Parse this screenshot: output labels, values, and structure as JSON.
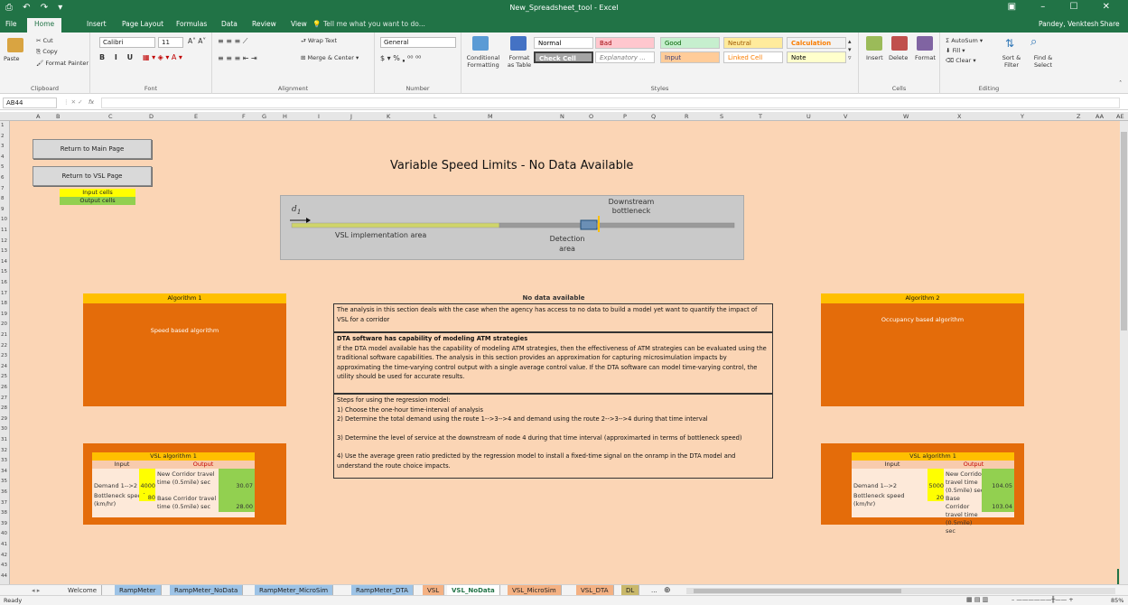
{
  "window": {
    "title": "New_Spreadsheet_tool - Excel",
    "user": "Pandey, Venktesh",
    "share": "Share"
  },
  "ribbon_tabs": [
    "File",
    "Home",
    "Insert",
    "Page Layout",
    "Formulas",
    "Data",
    "Review",
    "View"
  ],
  "tell_me": "Tell me what you want to do...",
  "clipboard": {
    "paste": "Paste",
    "cut": "Cut",
    "copy": "Copy",
    "format_painter": "Format Painter",
    "label": "Clipboard"
  },
  "font": {
    "name": "Calibri",
    "size": "11",
    "label": "Font"
  },
  "alignment": {
    "wrap": "Wrap Text",
    "merge": "Merge & Center",
    "label": "Alignment"
  },
  "number": {
    "format": "General",
    "label": "Number"
  },
  "styles": {
    "conditional": "Conditional Formatting",
    "format_table": "Format as Table",
    "cells": [
      {
        "label": "Normal",
        "bg": "#ffffff",
        "fg": "#000000"
      },
      {
        "label": "Bad",
        "bg": "#ffc7ce",
        "fg": "#9c0006"
      },
      {
        "label": "Good",
        "bg": "#c6efce",
        "fg": "#006100"
      },
      {
        "label": "Neutral",
        "bg": "#ffeb9c",
        "fg": "#9c5700"
      },
      {
        "label": "Calculation",
        "bg": "#f2f2f2",
        "fg": "#fa7d00"
      },
      {
        "label": "Check Cell",
        "bg": "#a5a5a5",
        "fg": "#ffffff"
      },
      {
        "label": "Explanatory ...",
        "bg": "#ffffff",
        "fg": "#7f7f7f"
      },
      {
        "label": "Input",
        "bg": "#ffcc99",
        "fg": "#3f3f76"
      },
      {
        "label": "Linked Cell",
        "bg": "#ffffff",
        "fg": "#fa7d00"
      },
      {
        "label": "Note",
        "bg": "#ffffcc",
        "fg": "#000000"
      }
    ],
    "label": "Styles"
  },
  "cells_group": {
    "insert": "Insert",
    "delete": "Delete",
    "format": "Format",
    "label": "Cells"
  },
  "editing": {
    "autosum": "AutoSum",
    "fill": "Fill",
    "clear": "Clear",
    "sort": "Sort & Filter",
    "find": "Find & Select",
    "label": "Editing"
  },
  "formula_bar": {
    "name_box": "AB44",
    "fx": "fx",
    "value": ""
  },
  "columns": [
    "A",
    "B",
    "C",
    "D",
    "E",
    "F",
    "G",
    "H",
    "I",
    "J",
    "K",
    "L",
    "M",
    "N",
    "O",
    "P",
    "Q",
    "R",
    "S",
    "T",
    "U",
    "V",
    "W",
    "X",
    "Y",
    "Z",
    "AA",
    "AE"
  ],
  "rows": [
    "1",
    "2",
    "3",
    "4",
    "5",
    "6",
    "7",
    "8",
    "9",
    "10",
    "11",
    "12",
    "13",
    "14",
    "15",
    "16",
    "17",
    "18",
    "19",
    "20",
    "21",
    "22",
    "23",
    "24",
    "25",
    "26",
    "27",
    "28",
    "29",
    "30",
    "31",
    "32",
    "33",
    "34",
    "35",
    "36",
    "37",
    "38",
    "39",
    "40",
    "41",
    "42",
    "43",
    "44"
  ],
  "buttons": {
    "main": "Return to Main Page",
    "vsl": "Return to VSL Page"
  },
  "legend": {
    "input": "Input cells",
    "output": "Output cells"
  },
  "page_title": "Variable Speed Limits - No Data Available",
  "diagram": {
    "d1": "d",
    "sub": "1",
    "downstream": "Downstream bottleneck",
    "vsl_area": "VSL implementation area",
    "detection": "Detection area"
  },
  "algo1": {
    "title": "Algorithm 1",
    "body": "Speed based algorithm"
  },
  "algo2": {
    "title": "Algorithm 2",
    "body": "Occupancy based algorithm"
  },
  "no_data": {
    "title": "No data available",
    "p1": "The analysis in this section deals with the case when the agency has access to no data to build a model yet want to quantify the impact of VSL for a corridor",
    "dta_title": "DTA software has capability of modeling ATM strategies",
    "dta_body": "If the DTA model available has the capability of modeling ATM strategies, then the effectiveness of ATM strategies can be evaluated using the traditional software capabilities. The analysis in this section provides an approximation for capturing microsimulation impacts by approximating the time-varying control output with a single average control value. If the DTA software can model time-varying control, the utility should be used for accurate results.",
    "steps_title": "Steps for using the regression model:",
    "s1": "1) Choose the one-hour time-interval of analysis",
    "s2": "2) Determine the total demand using the route 1-->3-->4 and demand using the route 2-->3-->4 during that time interval",
    "s3": "3) Determine the level of service at the downstream of node 4 during that time interval (approximarted in terms of bottleneck speed)",
    "s4": "4) Use the average green ratio predicted by the regression model to install a fixed-time signal on the onramp in the DTA model and understand the route choice impacts."
  },
  "vsl1": {
    "title": "VSL algorithm 1",
    "input": "Input",
    "output": "Output",
    "demand_label": "Demand 1-->2",
    "demand": "4000",
    "bn_label": "Bottleneck speed (km/hr)",
    "bn": "80",
    "new_label": "New Corridor travel time (0.5mile) sec",
    "new_val": "30.07",
    "base_label": "Base Corridor travel time (0.5mile) sec",
    "base_val": "28.00"
  },
  "vsl2": {
    "title": "VSL algorithm 1",
    "input": "Input",
    "output": "Output",
    "demand_label": "Demand 1-->2",
    "demand": "5000",
    "bn_label": "Bottleneck speed (km/hr)",
    "bn": "20",
    "new_label": "New Corridor travel time (0.5mile) sec",
    "new_val": "104.05",
    "base_label": "Base Corridor travel time (0.5mile) sec",
    "base_val": "103.04"
  },
  "sheet_tabs": [
    {
      "label": "Welcome",
      "bg": "#f3f3f3",
      "fg": "#333"
    },
    {
      "label": "RampMeter",
      "bg": "#9dc3e6",
      "fg": "#222"
    },
    {
      "label": "RampMeter_NoData",
      "bg": "#9dc3e6",
      "fg": "#222"
    },
    {
      "label": "RampMeter_MicroSim",
      "bg": "#9dc3e6",
      "fg": "#222"
    },
    {
      "label": "RampMeter_DTA",
      "bg": "#9dc3e6",
      "fg": "#222"
    },
    {
      "label": "VSL",
      "bg": "#f4b183",
      "fg": "#222"
    },
    {
      "label": "VSL_NoData",
      "bg": "#ffffff",
      "fg": "#217346"
    },
    {
      "label": "VSL_MicroSim",
      "bg": "#f4b183",
      "fg": "#222"
    },
    {
      "label": "VSL_DTA",
      "bg": "#f4b183",
      "fg": "#222"
    },
    {
      "label": "DL",
      "bg": "#c9b86a",
      "fg": "#222"
    }
  ],
  "status": {
    "ready": "Ready",
    "zoom": "85%"
  }
}
